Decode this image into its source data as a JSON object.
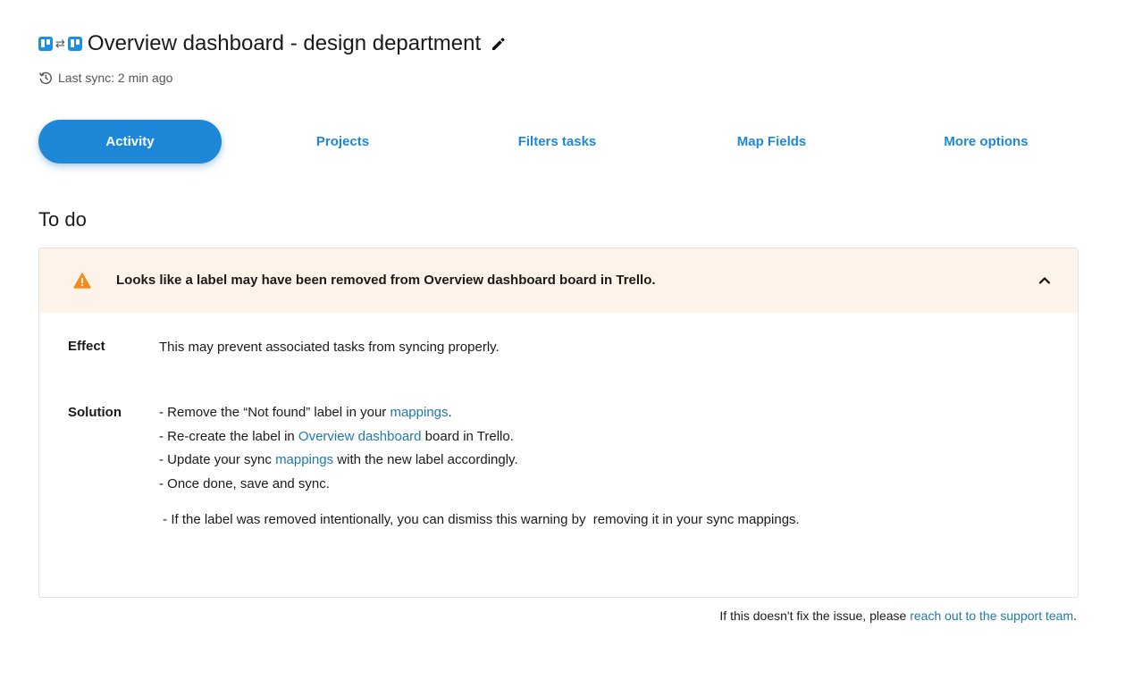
{
  "header": {
    "title": "Overview dashboard - design department",
    "swap_glyph": "⇄",
    "last_sync": "Last sync: 2 min ago"
  },
  "tabs": [
    {
      "label": "Activity",
      "active": true
    },
    {
      "label": "Projects",
      "active": false
    },
    {
      "label": "Filters tasks",
      "active": false
    },
    {
      "label": "Map Fields",
      "active": false
    },
    {
      "label": "More options",
      "active": false
    }
  ],
  "section": {
    "title": "To do"
  },
  "warning": {
    "message": "Looks like a label may have been removed from Overview dashboard  board in Trello.",
    "effect_label": "Effect",
    "effect_text": "This may prevent associated tasks from syncing properly.",
    "solution_label": "Solution",
    "solution": {
      "line1_pre": "- Remove the “Not found” label in your ",
      "line1_link": "mappings",
      "line1_post": ".",
      "line2_pre": "- Re-create the label in ",
      "line2_link": "Overview dashboard",
      "line2_post": " board in Trello.",
      "line3_pre": "- Update your sync ",
      "line3_link": "mappings",
      "line3_post": " with the new label accordingly.",
      "line4": "- Once done, save and sync.",
      "line5": " - If the label was removed intentionally, you can dismiss this warning by  removing it in your sync mappings."
    }
  },
  "footer": {
    "pre": "If this doesn't fix the issue, please ",
    "link": "reach out to the support team",
    "post": "."
  },
  "colors": {
    "accent": "#1e88d8",
    "link": "#1f7aa8",
    "warning_bg": "#fef3e8",
    "warning_icon": "#f08c1e"
  },
  "icons": {
    "board_left": "trello-board-icon",
    "swap": "swap-arrows-icon",
    "board_right": "trello-board-icon",
    "edit": "pencil-icon",
    "history": "history-icon",
    "warning": "warning-triangle-icon",
    "collapse": "chevron-up-icon"
  }
}
